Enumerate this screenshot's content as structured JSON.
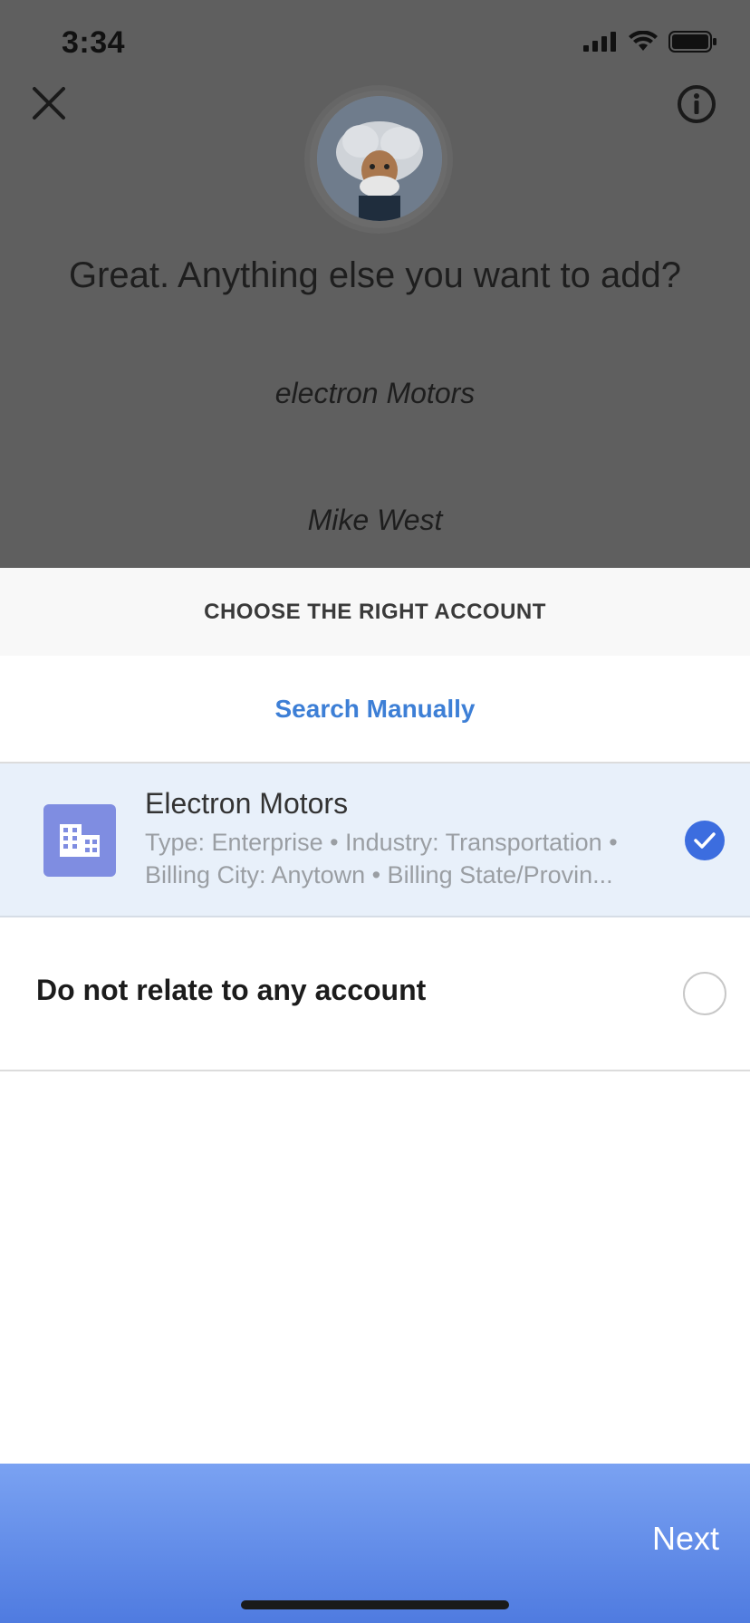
{
  "status_bar": {
    "time": "3:34"
  },
  "header": {
    "prompt": "Great. Anything else you want to add?",
    "echo_lines": [
      "electron Motors",
      "Mike West"
    ]
  },
  "sheet": {
    "title": "CHOOSE THE RIGHT ACCOUNT",
    "search_label": "Search Manually",
    "options": [
      {
        "name": "Electron Motors",
        "detail_line1": "Type: Enterprise • Industry: Transportation •",
        "detail_line2": "Billing City: Anytown • Billing State/Provin...",
        "selected": true,
        "icon": "building-icon"
      },
      {
        "name": "Do not relate to any account",
        "selected": false
      }
    ]
  },
  "footer": {
    "next_label": "Next"
  },
  "colors": {
    "accent": "#3d7fd6",
    "selected_row": "#e8f0fa",
    "check": "#3c6ddf",
    "account_icon": "#7f8de1",
    "footer_top": "#7aa2f2",
    "footer_bottom": "#4f7be0"
  }
}
